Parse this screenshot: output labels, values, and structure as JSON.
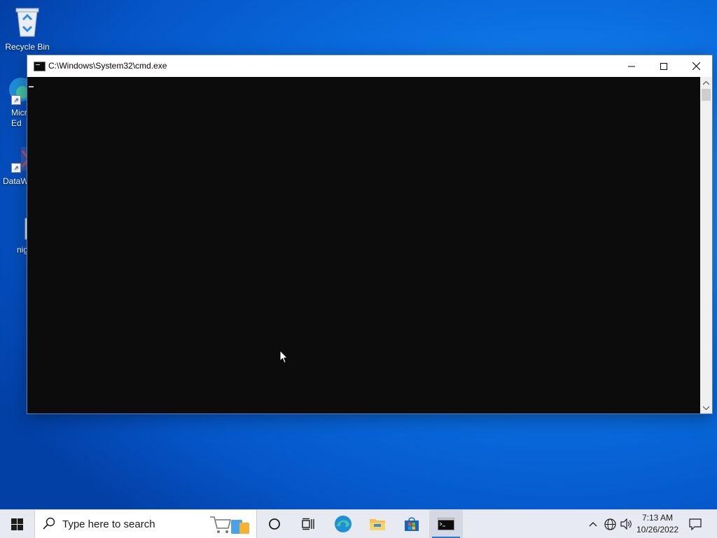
{
  "desktop": {
    "icons": [
      {
        "label": "Recycle Bin"
      },
      {
        "label": "Micr\nEd"
      },
      {
        "label": "DataW"
      },
      {
        "label": "nig"
      }
    ]
  },
  "window": {
    "title": "C:\\Windows\\System32\\cmd.exe",
    "console_background": "#0c0c0c",
    "controls": [
      "minimize-icon",
      "maximize-icon",
      "close-icon"
    ]
  },
  "taskbar": {
    "search_placeholder": "Type here to search",
    "pinned": [
      "cortana-icon",
      "task-view-icon",
      "edge-icon",
      "file-explorer-icon",
      "store-icon",
      "cmd-icon"
    ],
    "clock": {
      "time": "7:13 AM",
      "date": "10/26/2022"
    },
    "accent": "#2b7ad6"
  }
}
